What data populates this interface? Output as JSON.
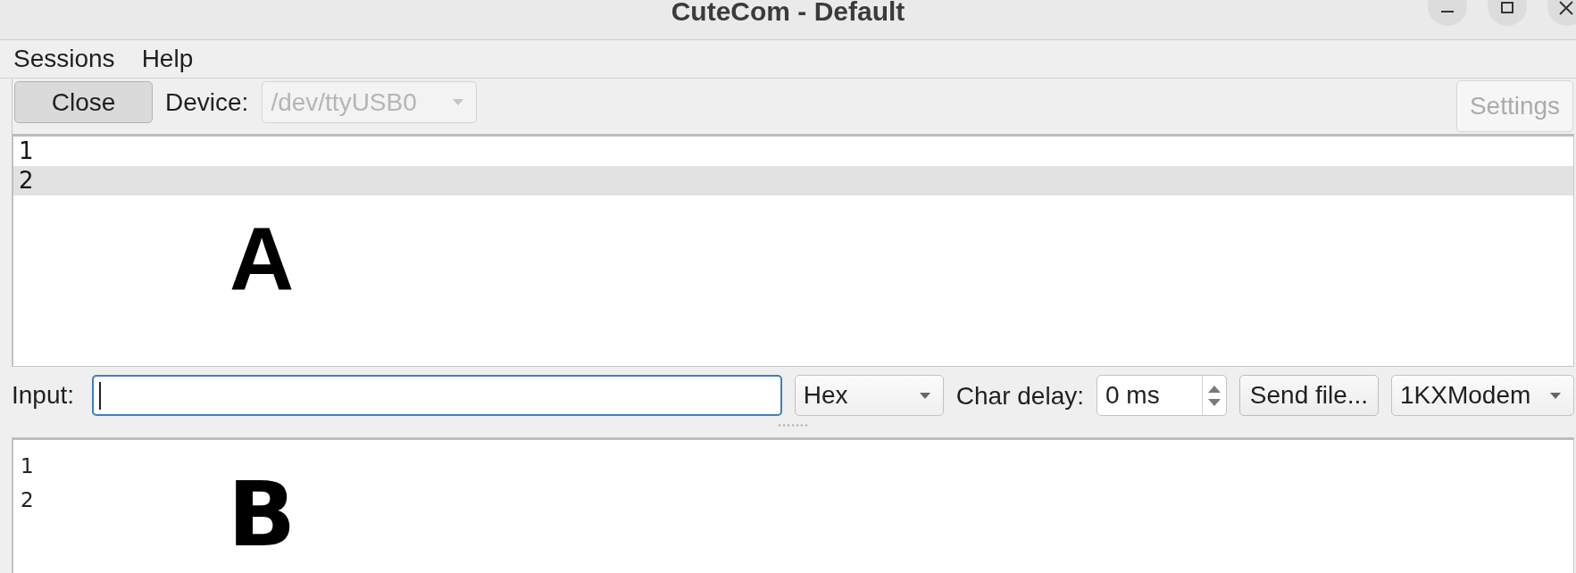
{
  "window": {
    "title": "CuteCom - Default",
    "controls": [
      {
        "kind": "minimize"
      },
      {
        "kind": "maximize"
      },
      {
        "kind": "close"
      }
    ]
  },
  "menu_bar": [
    {
      "label": "Sessions"
    },
    {
      "label": "Help"
    }
  ],
  "toolbar": {
    "close_button": {
      "label": "Close",
      "pressed": true
    },
    "device": {
      "label": "Device:",
      "value": "/dev/ttyUSB0",
      "disabled": true
    },
    "settings_button": {
      "label": "Settings",
      "disabled": true
    }
  },
  "output_a": {
    "lines": [
      {
        "text": "1",
        "current": false
      },
      {
        "text": "2",
        "current": true
      }
    ],
    "annotation": "A"
  },
  "input_bar": {
    "input": {
      "label": "Input:",
      "focused": true
    },
    "format": {
      "value": "Hex"
    },
    "char_delay": {
      "label": "Char delay:",
      "value": "0 ms"
    },
    "send_file_button": {
      "label": "Send file..."
    },
    "protocol": {
      "value": "1KXModem"
    }
  },
  "output_b": {
    "lines": [
      "1",
      "2"
    ],
    "annotation": "B"
  }
}
